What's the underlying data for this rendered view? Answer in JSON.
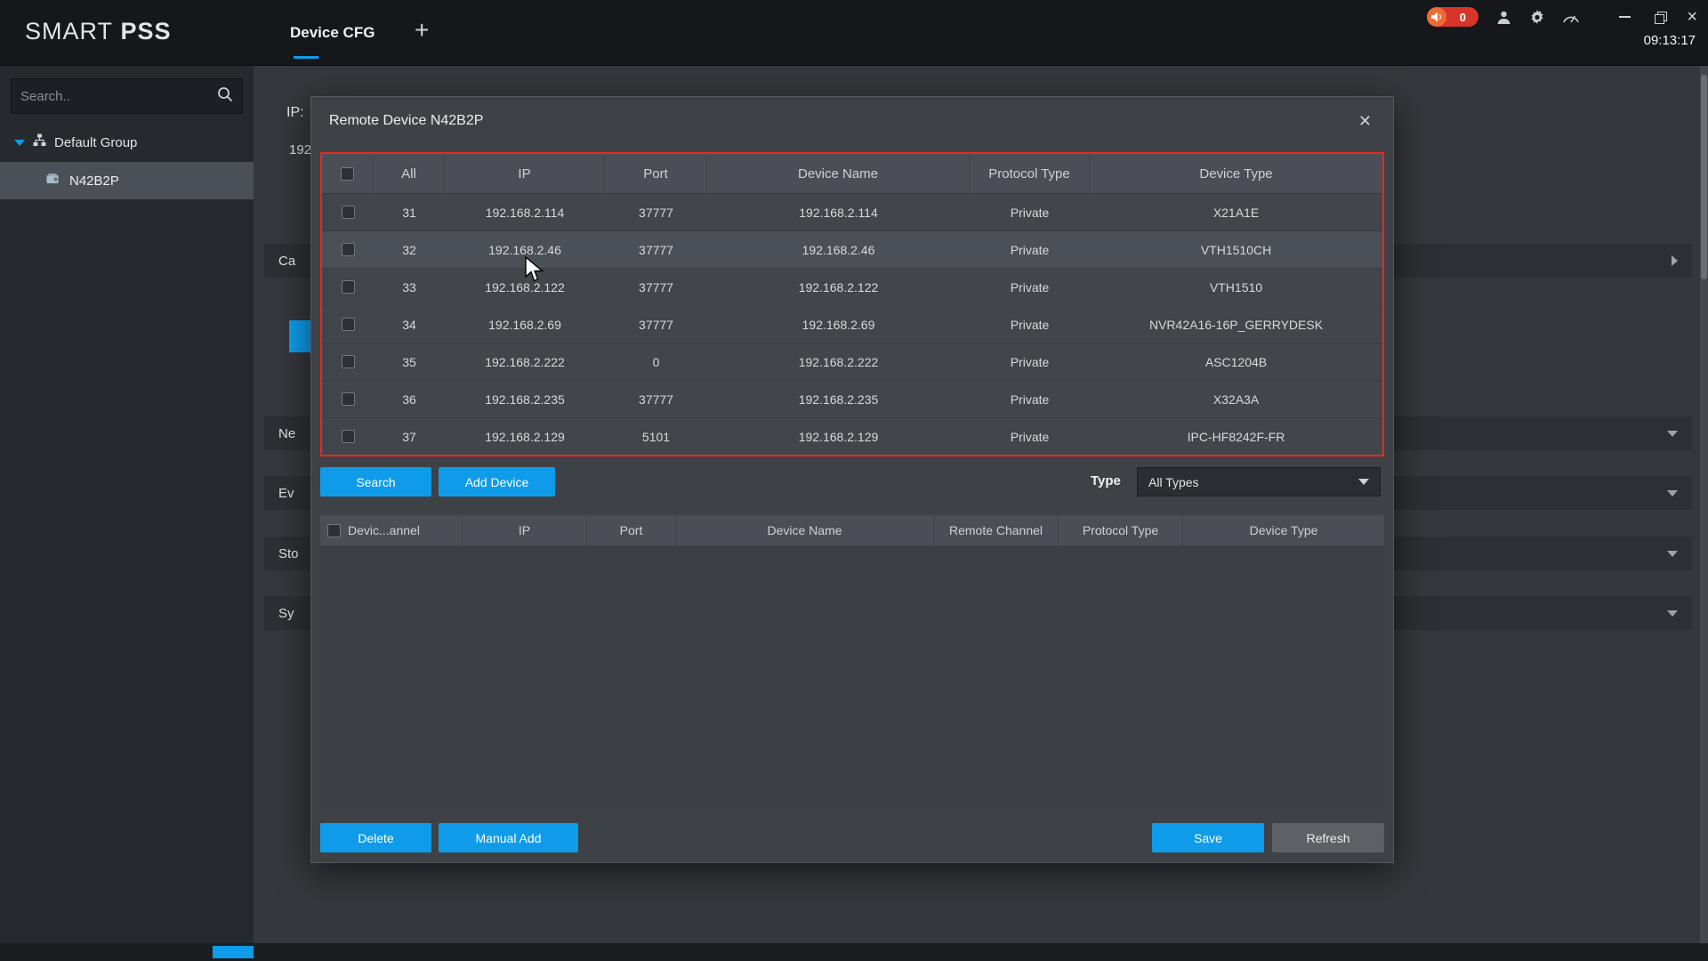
{
  "titlebar": {
    "logo_smart": "SMART",
    "logo_pss": "PSS",
    "tab": "Device CFG",
    "plus": "+",
    "badge_count": "0",
    "time": "09:13:17",
    "close_glyph": "×"
  },
  "sidebar": {
    "search_placeholder": "Search..",
    "group_label": "Default Group",
    "device_label": "N42B2P"
  },
  "background": {
    "ip_label": "IP:",
    "ip_partial": "192",
    "sections": [
      "Ca",
      "Ne",
      "Ev",
      "Sto",
      "Sy"
    ]
  },
  "modal": {
    "title": "Remote Device N42B2P",
    "close": "✕",
    "type_label": "Type",
    "type_value": "All Types",
    "buttons": {
      "search": "Search",
      "add_device": "Add Device",
      "delete": "Delete",
      "manual_add": "Manual Add",
      "save": "Save",
      "refresh": "Refresh"
    },
    "discovered": {
      "headers": [
        "All",
        "IP",
        "Port",
        "Device Name",
        "Protocol Type",
        "Device Type"
      ],
      "rows": [
        {
          "no": "31",
          "ip": "192.168.2.114",
          "port": "37777",
          "name": "192.168.2.114",
          "protocol": "Private",
          "type": "X21A1E"
        },
        {
          "no": "32",
          "ip": "192.168.2.46",
          "port": "37777",
          "name": "192.168.2.46",
          "protocol": "Private",
          "type": "VTH1510CH"
        },
        {
          "no": "33",
          "ip": "192.168.2.122",
          "port": "37777",
          "name": "192.168.2.122",
          "protocol": "Private",
          "type": "VTH1510"
        },
        {
          "no": "34",
          "ip": "192.168.2.69",
          "port": "37777",
          "name": "192.168.2.69",
          "protocol": "Private",
          "type": "NVR42A16-16P_GERRYDESK"
        },
        {
          "no": "35",
          "ip": "192.168.2.222",
          "port": "0",
          "name": "192.168.2.222",
          "protocol": "Private",
          "type": "ASC1204B"
        },
        {
          "no": "36",
          "ip": "192.168.2.235",
          "port": "37777",
          "name": "192.168.2.235",
          "protocol": "Private",
          "type": "X32A3A"
        },
        {
          "no": "37",
          "ip": "192.168.2.129",
          "port": "5101",
          "name": "192.168.2.129",
          "protocol": "Private",
          "type": "IPC-HF8242F-FR"
        }
      ]
    },
    "added": {
      "headers": [
        "Devic...annel",
        "IP",
        "Port",
        "Device Name",
        "Remote Channel",
        "Protocol Type",
        "Device Type"
      ]
    }
  }
}
